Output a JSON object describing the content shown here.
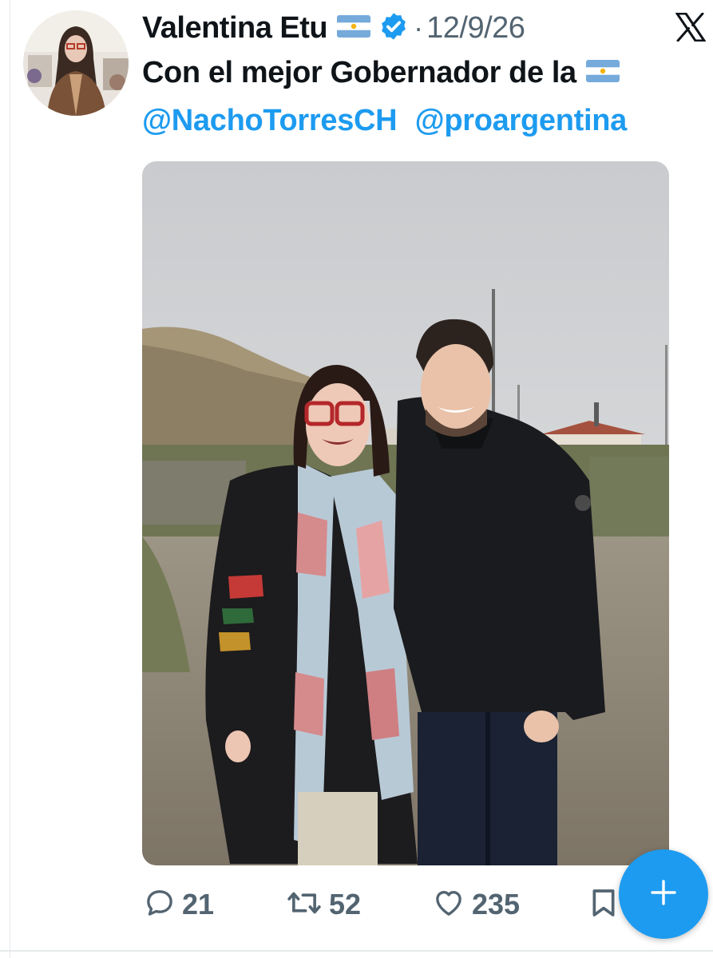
{
  "author": {
    "display_name": "Valentina Etu",
    "flag_icon": "argentina-flag-icon",
    "verified_icon": "verified-badge-icon",
    "separator": "·",
    "timestamp": "12/9/26"
  },
  "platform": {
    "logo_icon": "x-logo-icon"
  },
  "tweet": {
    "text": "Con el mejor Gobernador de la",
    "text_flag_icon": "argentina-flag-icon",
    "mentions": [
      "@NachoTorresCH",
      "@proargentina"
    ]
  },
  "actions": {
    "replies": "21",
    "retweets": "52",
    "likes": "235",
    "reply_icon": "reply-icon",
    "retweet_icon": "retweet-icon",
    "like_icon": "heart-icon",
    "bookmark_icon": "bookmark-icon"
  },
  "compose": {
    "icon": "plus-icon"
  },
  "colors": {
    "link": "#1d9bf0",
    "muted": "#536471",
    "text": "#0f1419",
    "fab": "#1d9bf0"
  }
}
